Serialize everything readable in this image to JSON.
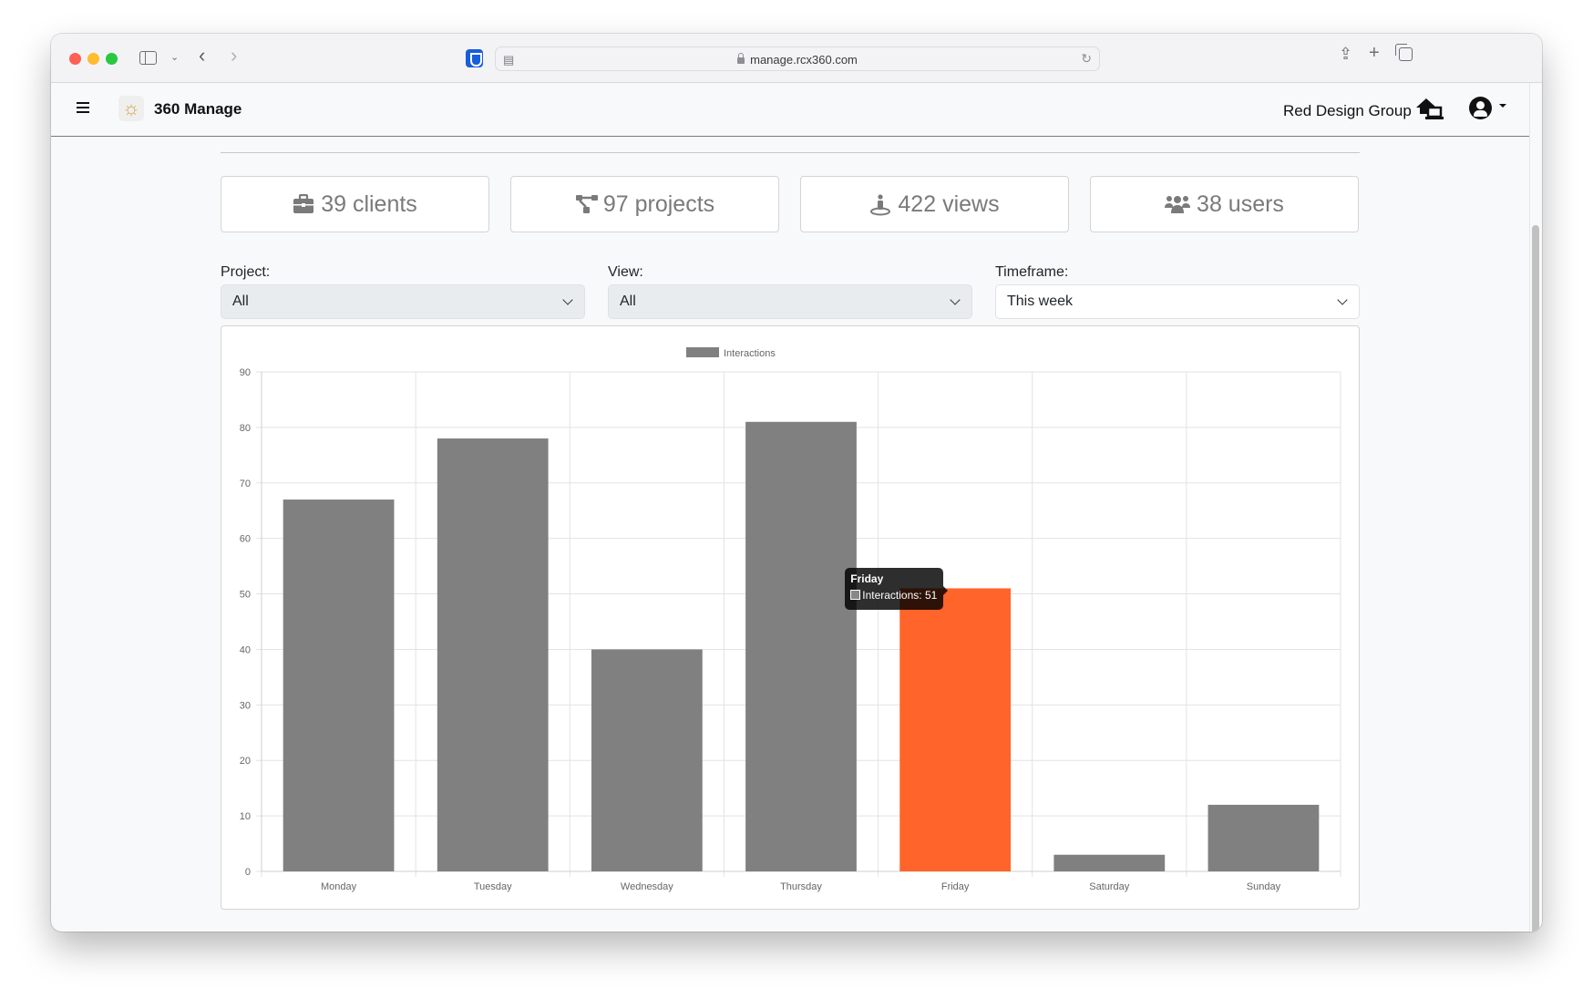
{
  "browser": {
    "url": "manage.rcx360.com"
  },
  "app": {
    "brand": "360 Manage",
    "organization": "Red Design Group"
  },
  "stats": [
    {
      "icon": "briefcase-icon",
      "label": "39 clients"
    },
    {
      "icon": "project-diagram-icon",
      "label": "97 projects"
    },
    {
      "icon": "street-view-icon",
      "label": "422 views"
    },
    {
      "icon": "users-icon",
      "label": "38 users"
    }
  ],
  "filters": {
    "project": {
      "label": "Project:",
      "value": "All"
    },
    "view": {
      "label": "View:",
      "value": "All"
    },
    "timeframe": {
      "label": "Timeframe:",
      "value": "This week"
    }
  },
  "colors": {
    "bar": "#808080",
    "highlight": "#ff642b"
  },
  "tooltip": {
    "title": "Friday",
    "body": "Interactions: 51"
  },
  "chart_data": {
    "type": "bar",
    "title": "",
    "xlabel": "",
    "ylabel": "",
    "legend": {
      "entries": [
        "Interactions"
      ],
      "position": "top-center"
    },
    "categories": [
      "Monday",
      "Tuesday",
      "Wednesday",
      "Thursday",
      "Friday",
      "Saturday",
      "Sunday"
    ],
    "series": [
      {
        "name": "Interactions",
        "values": [
          67,
          78,
          40,
          81,
          51,
          3,
          12
        ]
      }
    ],
    "highlighted_category": "Friday",
    "ylim": [
      0,
      90
    ],
    "yticks": [
      0,
      10,
      20,
      30,
      40,
      50,
      60,
      70,
      80,
      90
    ],
    "grid": true
  }
}
